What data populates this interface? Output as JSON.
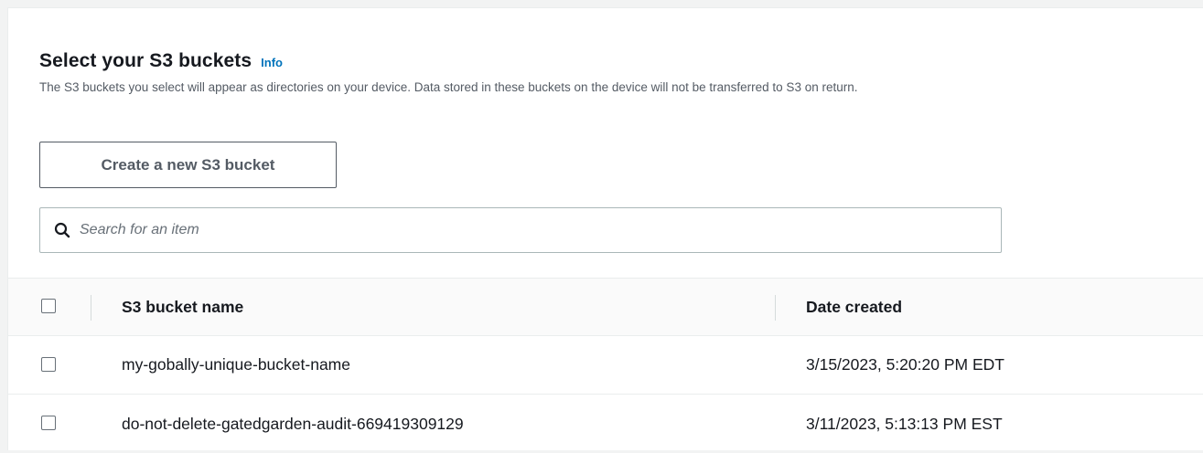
{
  "section": {
    "title": "Select your S3 buckets",
    "info_label": "Info",
    "description": "The S3 buckets you select will appear as directories on your device. Data stored in these buckets on the device will not be transferred to S3 on return."
  },
  "create_button": {
    "label": "Create a new S3 bucket"
  },
  "search": {
    "placeholder": "Search for an item",
    "value": "",
    "icon": "search-icon"
  },
  "table": {
    "columns": [
      "S3 bucket name",
      "Date created"
    ],
    "rows": [
      {
        "name": "my-gobally-unique-bucket-name",
        "date": "3/15/2023, 5:20:20 PM EDT",
        "selected": false
      },
      {
        "name": "do-not-delete-gatedgarden-audit-669419309129",
        "date": "3/11/2023, 5:13:13 PM EST",
        "selected": false
      }
    ]
  },
  "colors": {
    "link": "#0073bb",
    "text": "#16191f",
    "secondary_text": "#545b64",
    "background": "#f2f3f3"
  }
}
